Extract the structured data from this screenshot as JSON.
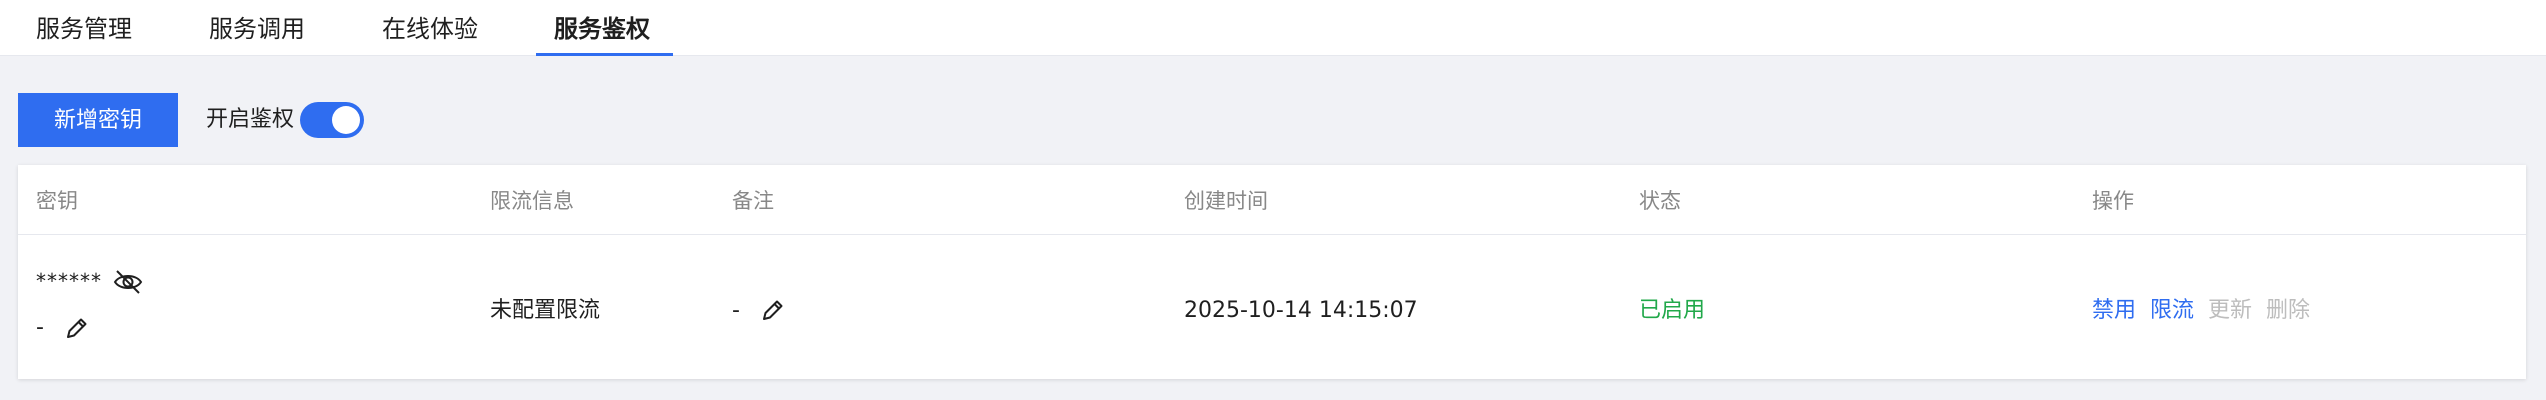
{
  "tabs": [
    {
      "label": "服务管理"
    },
    {
      "label": "服务调用"
    },
    {
      "label": "在线体验"
    },
    {
      "label": "服务鉴权",
      "active": true
    }
  ],
  "toolbar": {
    "add_key_label": "新增密钥",
    "auth_switch_label": "开启鉴权",
    "auth_enabled": true
  },
  "table": {
    "columns": [
      "密钥",
      "限流信息",
      "备注",
      "创建时间",
      "状态",
      "操作"
    ],
    "rows": [
      {
        "key_masked": "******",
        "key_note": "-",
        "rate_limit": "未配置限流",
        "remark": "-",
        "created_at": "2025-10-14 14:15:07",
        "status": "已启用",
        "actions": {
          "disable": "禁用",
          "limit": "限流",
          "update": "更新",
          "delete": "删除"
        }
      }
    ]
  },
  "colors": {
    "primary": "#2f6df0",
    "status_enabled": "#21a84a",
    "disabled_text": "#bdbdbd",
    "header_text": "#888888"
  }
}
